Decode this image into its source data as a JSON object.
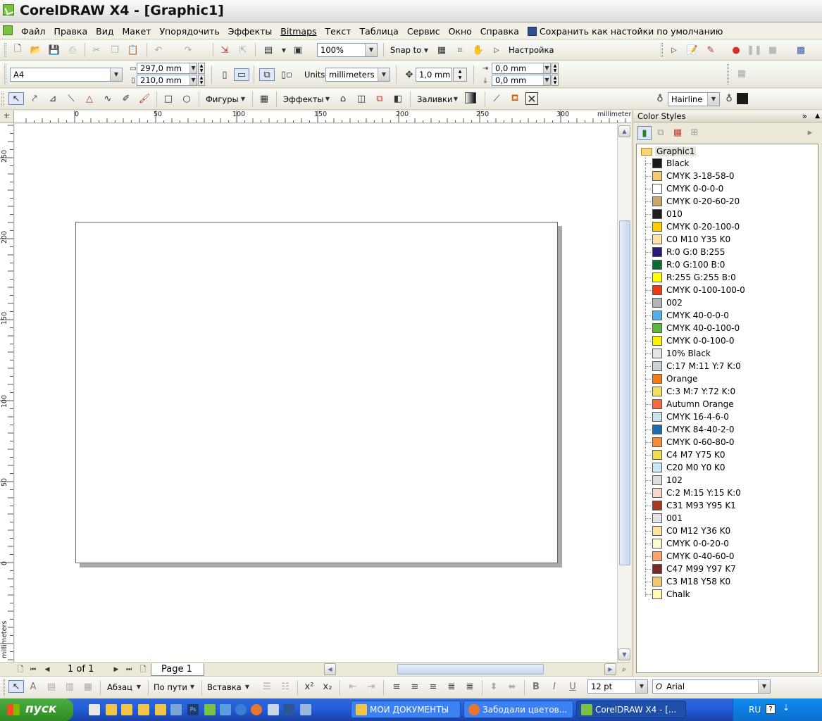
{
  "window": {
    "title": "CorelDRAW X4 - [Graphic1]"
  },
  "menu": {
    "items": [
      "Файл",
      "Правка",
      "Вид",
      "Макет",
      "Упорядочить",
      "Эффекты",
      "Bitmaps",
      "Текст",
      "Таблица",
      "Сервис",
      "Окно",
      "Справка"
    ],
    "save_default": "Сохранить как настойки по умолчанию"
  },
  "standard_toolbar": {
    "zoom": "100%",
    "snap_to": "Snap to",
    "options": "Настройка"
  },
  "property_bar": {
    "paper_size": "A4",
    "width": "297,0 mm",
    "height": "210,0 mm",
    "units_label": "Units:",
    "units": "millimeters",
    "nudge": "1,0 mm",
    "dup_x": "0,0 mm",
    "dup_y": "0,0 mm"
  },
  "toolbox": {
    "shapes": "Фигуры",
    "effects": "Эффекты",
    "fills": "Заливки",
    "outline": "Hairline"
  },
  "rulers": {
    "unit": "millimeters",
    "h_labels": [
      "0",
      "50",
      "100",
      "150",
      "200",
      "250",
      "300"
    ],
    "v_labels": [
      "250",
      "200",
      "150",
      "100",
      "50",
      "0"
    ]
  },
  "navigator": {
    "page_count": "1 of 1",
    "page_tab": "Page 1"
  },
  "docker": {
    "title": "Color Styles",
    "root": "Graphic1",
    "items": [
      {
        "name": "Black",
        "color": "#1a1a1a"
      },
      {
        "name": "CMYK 3-18-58-0",
        "color": "#f3c974"
      },
      {
        "name": "CMYK 0-0-0-0",
        "color": "#ffffff"
      },
      {
        "name": "CMYK 0-20-60-20",
        "color": "#c9a76a"
      },
      {
        "name": "010",
        "color": "#1f1f1f"
      },
      {
        "name": "CMYK 0-20-100-0",
        "color": "#ffcc00"
      },
      {
        "name": "C0 M10 Y35 K0",
        "color": "#ffe3a8"
      },
      {
        "name": "R:0 G:0 B:255",
        "color": "#2b1a7a"
      },
      {
        "name": "R:0 G:100 B:0",
        "color": "#0b6b35"
      },
      {
        "name": "R:255 G:255 B:0",
        "color": "#ffff00"
      },
      {
        "name": "CMYK 0-100-100-0",
        "color": "#ea3a12"
      },
      {
        "name": "002",
        "color": "#b5b5b5"
      },
      {
        "name": "CMYK 40-0-0-0",
        "color": "#4fb0ec"
      },
      {
        "name": "CMYK 40-0-100-0",
        "color": "#5ab83c"
      },
      {
        "name": "CMYK 0-0-100-0",
        "color": "#fff200"
      },
      {
        "name": "10% Black",
        "color": "#e6e6e6"
      },
      {
        "name": "C:17 M:11 Y:7 K:0",
        "color": "#ccd0d8"
      },
      {
        "name": "Orange",
        "color": "#f47b12"
      },
      {
        "name": "C:3 M:7 Y:72 K:0",
        "color": "#f5df63"
      },
      {
        "name": "Autumn Orange",
        "color": "#f26a3e"
      },
      {
        "name": "CMYK 16-4-6-0",
        "color": "#c9e2ec"
      },
      {
        "name": "CMYK 84-40-2-0",
        "color": "#1d6bb0"
      },
      {
        "name": "CMYK 0-60-80-0",
        "color": "#f58a3a"
      },
      {
        "name": "C4 M7 Y75 K0",
        "color": "#f2dc56"
      },
      {
        "name": "C20 M0 Y0 K0",
        "color": "#c8e6f7"
      },
      {
        "name": "102",
        "color": "#dddddd"
      },
      {
        "name": "C:2 M:15 Y:15 K:0",
        "color": "#f6d7cb"
      },
      {
        "name": "C31 M93 Y95 K1",
        "color": "#a83822"
      },
      {
        "name": "001",
        "color": "#e3e3e3"
      },
      {
        "name": "C0 M12 Y36 K0",
        "color": "#ffe1a5"
      },
      {
        "name": "CMYK 0-0-20-0",
        "color": "#fffbd0"
      },
      {
        "name": "CMYK 0-40-60-0",
        "color": "#f8a66e"
      },
      {
        "name": "C47 M99 Y97 K7",
        "color": "#7c2a26"
      },
      {
        "name": "C3 M18 Y58 K0",
        "color": "#f3c870"
      },
      {
        "name": "Chalk",
        "color": "#fffbb4"
      }
    ]
  },
  "text_toolbar": {
    "paragraph": "Абзац",
    "on_path": "По пути",
    "insert": "Вставка",
    "font_size": "12 pt",
    "font_name": "Arial"
  },
  "taskbar": {
    "start": "пуск",
    "tasks": [
      "МОИ ДОКУМЕНТЫ",
      "Забодали цветов...",
      "CorelDRAW X4 - [..."
    ],
    "lang": "RU"
  }
}
